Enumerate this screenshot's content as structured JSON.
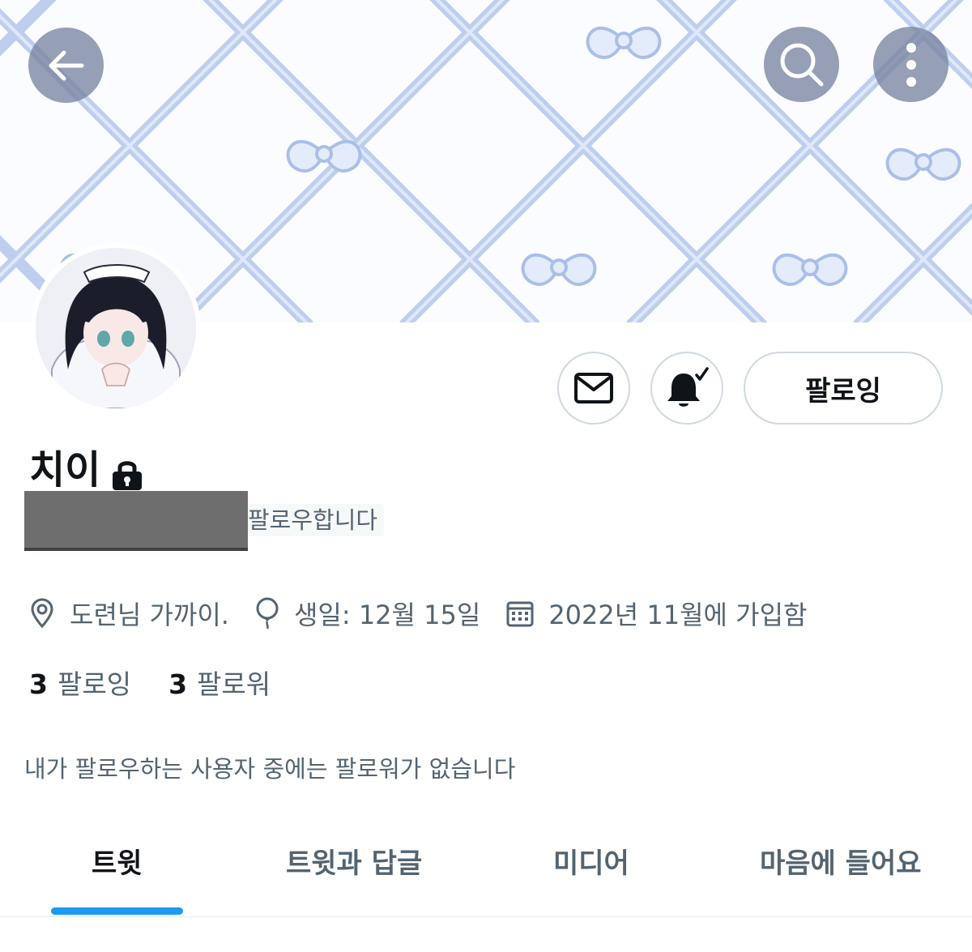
{
  "header": {
    "back_icon": "arrow-left-icon",
    "search_icon": "search-icon",
    "more_icon": "more-vertical-icon"
  },
  "profile": {
    "display_name": "치이",
    "protected_icon": "lock-icon",
    "follows_you": "팔로우합니다",
    "actions": {
      "message_icon": "mail-icon",
      "notify_icon": "bell-check-icon",
      "follow_label": "팔로잉"
    },
    "location": "도련님 가까이.",
    "location_icon": "location-pin-icon",
    "birthday": "생일: 12월 15일",
    "birthday_icon": "balloon-icon",
    "joined": "2022년 11월에 가입함",
    "joined_icon": "calendar-icon",
    "following_count": "3",
    "following_label": "팔로잉",
    "followers_count": "3",
    "followers_label": "팔로워",
    "no_common_followers": "내가 팔로우하는 사용자 중에는 팔로워가 없습니다"
  },
  "tabs": [
    {
      "label": "트윗",
      "active": true
    },
    {
      "label": "트윗과 답글",
      "active": false
    },
    {
      "label": "미디어",
      "active": false
    },
    {
      "label": "마음에 들어요",
      "active": false
    }
  ],
  "colors": {
    "accent": "#1d9bf0",
    "secondary_text": "#536471",
    "primary_text": "#0f1419",
    "banner_ribbon": "#a8bde6"
  }
}
